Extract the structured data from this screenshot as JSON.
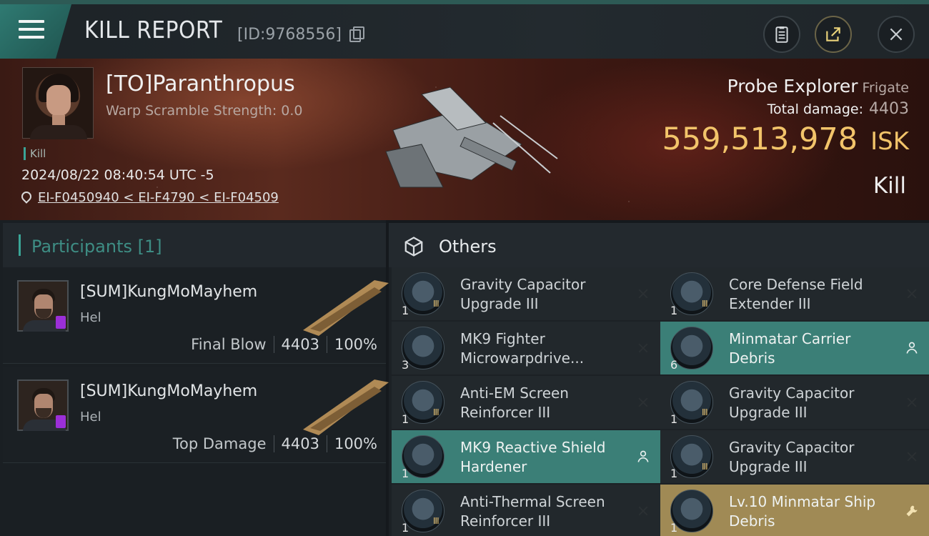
{
  "header": {
    "title": "KILL REPORT",
    "report_id": "[ID:9768556]",
    "menu_icon": "hamburger-icon",
    "buttons": [
      "clipboard-icon",
      "share-icon",
      "close-icon"
    ]
  },
  "victim": {
    "name": "[TO]Paranthropus",
    "warp_scramble": "Warp Scramble Strength: 0.0",
    "tag": "Kill",
    "timestamp": "2024/08/22 08:40:54 UTC -5",
    "location": "EI-F0450940 < EI-F4790 < EI-F04509",
    "ship_name": "Probe Explorer",
    "ship_class": "Frigate",
    "total_damage_label": "Total damage:",
    "total_damage": "4403",
    "isk_value": "559,513,978",
    "isk_unit": "ISK",
    "result": "Kill"
  },
  "participants": {
    "title": "Participants [1]",
    "rows": [
      {
        "name": "[SUM]KungMoMayhem",
        "ship": "Hel",
        "role": "Final Blow",
        "damage": "4403",
        "percent": "100%"
      },
      {
        "name": "[SUM]KungMoMayhem",
        "ship": "Hel",
        "role": "Top Damage",
        "damage": "4403",
        "percent": "100%"
      }
    ]
  },
  "others": {
    "title": "Others",
    "items": [
      {
        "name": "Gravity Capacitor Upgrade III",
        "qty": "1",
        "mark": "III",
        "state": "destroyed",
        "action": "close-icon"
      },
      {
        "name": "Core Defense Field Extender III",
        "qty": "1",
        "mark": "III",
        "state": "destroyed",
        "action": "close-icon"
      },
      {
        "name": "MK9 Fighter Microwarpdrive...",
        "qty": "3",
        "mark": "",
        "state": "destroyed",
        "action": "close-icon"
      },
      {
        "name": "Minmatar Carrier Debris",
        "qty": "6",
        "mark": "",
        "state": "dropped",
        "action": "person-icon"
      },
      {
        "name": "Anti-EM Screen Reinforcer III",
        "qty": "1",
        "mark": "III",
        "state": "destroyed",
        "action": "close-icon"
      },
      {
        "name": "Gravity Capacitor Upgrade III",
        "qty": "1",
        "mark": "III",
        "state": "destroyed",
        "action": "close-icon"
      },
      {
        "name": "MK9 Reactive Shield Hardener",
        "qty": "1",
        "mark": "",
        "state": "dropped",
        "action": "person-icon"
      },
      {
        "name": "Gravity Capacitor Upgrade III",
        "qty": "1",
        "mark": "III",
        "state": "destroyed",
        "action": "close-icon"
      },
      {
        "name": "Anti-Thermal Screen Reinforcer III",
        "qty": "1",
        "mark": "III",
        "state": "destroyed",
        "action": "close-icon"
      },
      {
        "name": "Lv.10 Minmatar Ship Debris",
        "qty": "1",
        "mark": "",
        "state": "special",
        "action": "wrench-icon"
      }
    ]
  },
  "colors": {
    "accent_teal": "#3aa597",
    "isk_gold": "#f2c46a",
    "dropped_bg": "#3b7f77",
    "special_bg": "#a08a55"
  }
}
